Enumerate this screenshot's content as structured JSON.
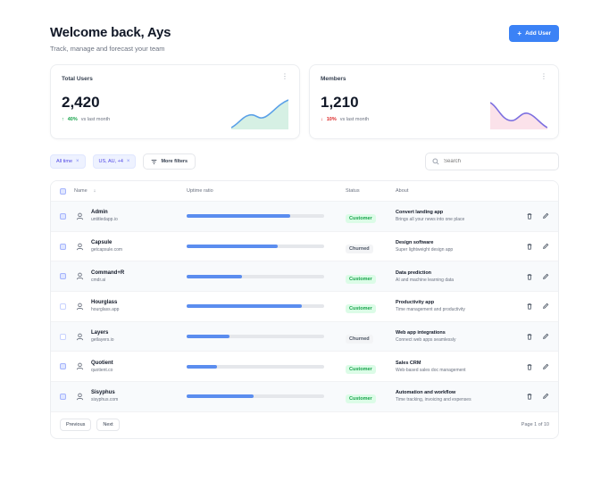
{
  "header": {
    "title": "Welcome back, Ays",
    "subtitle": "Track, manage and forecast your team",
    "add_button_label": "Add User"
  },
  "cards": [
    {
      "label": "Total Users",
      "value": "2,420",
      "trend_value": "40%",
      "trend_text": "vs last month",
      "trend_direction": "up",
      "spark_color": "#5aa0e8",
      "spark_fill": "#d6f0e4"
    },
    {
      "label": "Members",
      "value": "1,210",
      "trend_value": "10%",
      "trend_text": "vs last month",
      "trend_direction": "down",
      "spark_color": "#7c6fe0",
      "spark_fill": "#fbe2ea"
    }
  ],
  "filters": {
    "chips": [
      "All time",
      "US, AU, +4"
    ],
    "more_filters_label": "More filters",
    "search_placeholder": "Search"
  },
  "table": {
    "columns": [
      "Name",
      "Uptime ratio",
      "Status",
      "About"
    ],
    "rows": [
      {
        "name": "Admin",
        "handle": "untitledapp.io",
        "progress": 0.75,
        "status": "Customer",
        "status_kind": "green",
        "about_title": "Convert landing app",
        "about_desc": "Brings all your news into one place",
        "checked": true
      },
      {
        "name": "Capsule",
        "handle": "getcapsule.com",
        "progress": 0.66,
        "status": "Churned",
        "status_kind": "gray",
        "about_title": "Design software",
        "about_desc": "Super lightweight design app",
        "checked": true
      },
      {
        "name": "Command+R",
        "handle": "cmdr.ai",
        "progress": 0.4,
        "status": "Customer",
        "status_kind": "green",
        "about_title": "Data prediction",
        "about_desc": "AI and machine learning data",
        "checked": true
      },
      {
        "name": "Hourglass",
        "handle": "hourglass.app",
        "progress": 0.84,
        "status": "Customer",
        "status_kind": "green",
        "about_title": "Productivity app",
        "about_desc": "Time management and productivity",
        "checked": false
      },
      {
        "name": "Layers",
        "handle": "getlayers.io",
        "progress": 0.31,
        "status": "Churned",
        "status_kind": "gray",
        "about_title": "Web app integrations",
        "about_desc": "Connect web apps seamlessly",
        "checked": false
      },
      {
        "name": "Quotient",
        "handle": "quotient.co",
        "progress": 0.22,
        "status": "Customer",
        "status_kind": "green",
        "about_title": "Sales CRM",
        "about_desc": "Web-based sales doc management",
        "checked": true
      },
      {
        "name": "Sisyphus",
        "handle": "sisyphus.com",
        "progress": 0.49,
        "status": "Customer",
        "status_kind": "green",
        "about_title": "Automation and workflow",
        "about_desc": "Time tracking, invoicing and expenses",
        "checked": true
      }
    ]
  },
  "pagination": {
    "previous_label": "Previous",
    "next_label": "Next",
    "page_info": "Page 1 of 10"
  }
}
